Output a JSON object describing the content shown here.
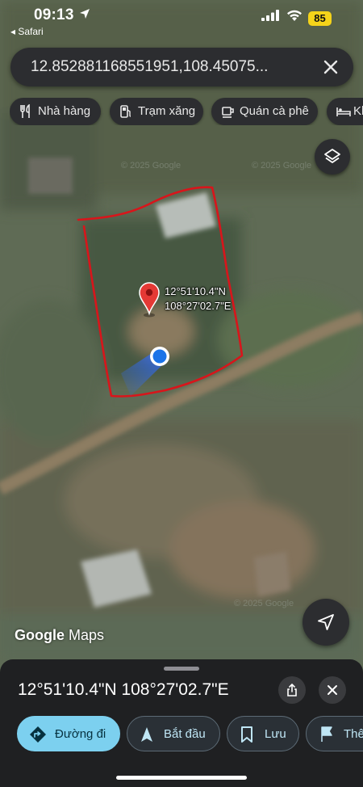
{
  "status_bar": {
    "time": "09:13",
    "back_app": "◂ Safari",
    "battery": "85"
  },
  "search": {
    "query": "12.852881168551951,108.45075..."
  },
  "categories": [
    {
      "label": "Nhà hàng",
      "icon": "fork-knife-icon"
    },
    {
      "label": "Trạm xăng",
      "icon": "gas-station-icon"
    },
    {
      "label": "Quán cà phê",
      "icon": "coffee-cup-icon"
    },
    {
      "label": "Kh",
      "icon": "bed-icon"
    }
  ],
  "map": {
    "pin_label_lat": "12°51'10.4\"N",
    "pin_label_lng": "108°27'02.7\"E",
    "watermarks": [
      "© 2025 Google",
      "© 2025 Google",
      "© 2025 Google"
    ],
    "logo_bold": "Google",
    "logo_rest": " Maps",
    "colors": {
      "annotation": "#d8151b",
      "pin": "#e53935",
      "location_dot": "#1a73e8"
    }
  },
  "sheet": {
    "title": "12°51'10.4\"N 108°27'02.7\"E"
  },
  "actions": [
    {
      "label": "Đường đi",
      "icon": "directions-icon",
      "primary": true
    },
    {
      "label": "Bắt đầu",
      "icon": "navigation-arrow-icon",
      "primary": false
    },
    {
      "label": "Lưu",
      "icon": "bookmark-icon",
      "primary": false
    },
    {
      "label": "Thê",
      "icon": "flag-icon",
      "primary": false
    }
  ]
}
